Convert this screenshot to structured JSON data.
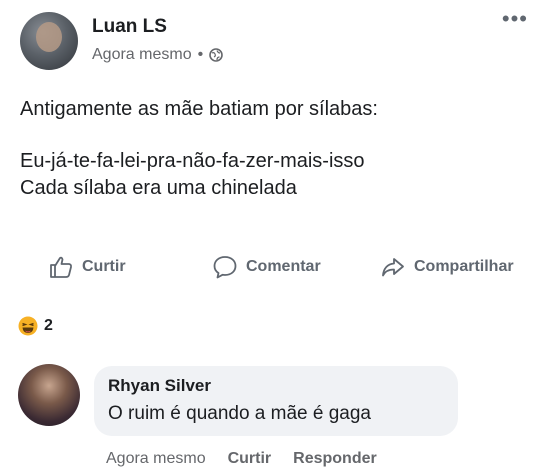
{
  "post": {
    "author": "Luan LS",
    "timestamp": "Agora mesmo",
    "separator": "•",
    "privacy_icon": "globe-icon",
    "more_icon": "•••",
    "text_line1": "Antigamente as mãe batiam por sílabas:",
    "text_line2": "Eu-já-te-fa-lei-pra-não-fa-zer-mais-isso",
    "text_line3": "Cada sílaba era uma chinelada"
  },
  "actions": {
    "like": "Curtir",
    "comment": "Comentar",
    "share": "Compartilhar"
  },
  "reactions": {
    "icon": "haha-emoji-icon",
    "count": "2"
  },
  "comment": {
    "author": "Rhyan Silver",
    "text": "O ruim é quando a mãe é gaga",
    "timestamp": "Agora mesmo",
    "like": "Curtir",
    "reply": "Responder"
  },
  "colors": {
    "text": "#1c1e21",
    "secondary": "#65676b",
    "bubble": "#f0f2f5",
    "haha": "#f7b125"
  }
}
